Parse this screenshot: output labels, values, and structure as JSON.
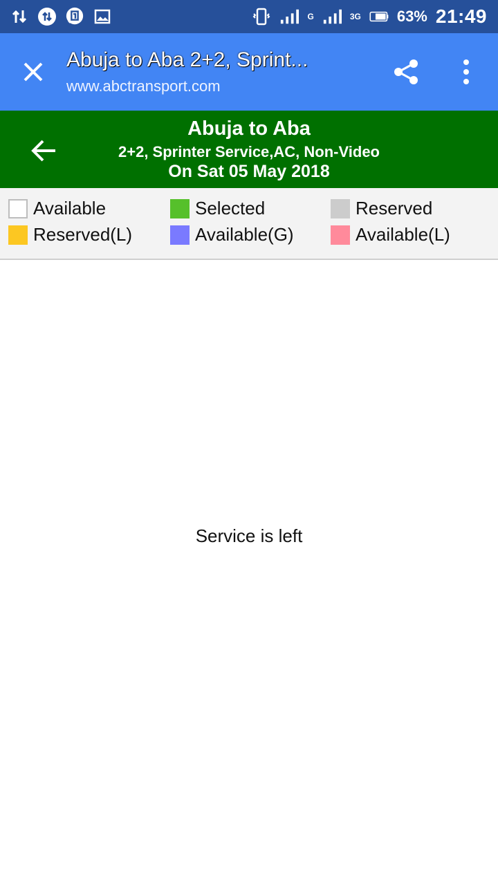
{
  "status_bar": {
    "network_small": "G",
    "network_3g": "3G",
    "battery_pct": "63%",
    "time": "21:49"
  },
  "toolbar": {
    "title": "Abuja to Aba 2+2, Sprint...",
    "url": "www.abctransport.com"
  },
  "route": {
    "title": "Abuja to Aba",
    "service": "2+2, Sprinter Service,AC, Non-Video",
    "date": "On Sat 05 May 2018"
  },
  "legend": [
    {
      "label": "Available",
      "color": "#ffffff"
    },
    {
      "label": "Selected",
      "color": "#56c02b"
    },
    {
      "label": "Reserved",
      "color": "#cccccc"
    },
    {
      "label": "Reserved(L)",
      "color": "#fcc722"
    },
    {
      "label": "Available(G)",
      "color": "#7a7aff"
    },
    {
      "label": "Available(L)",
      "color": "#ff8a9b"
    }
  ],
  "main": {
    "message": "Service is left"
  },
  "colors": {
    "status_bar": "#26509a",
    "toolbar": "#4285f4",
    "header": "#007000"
  }
}
